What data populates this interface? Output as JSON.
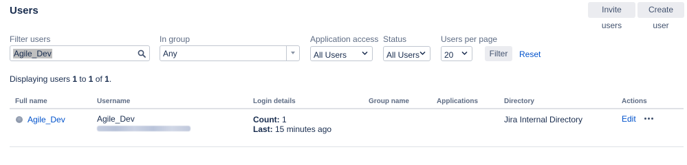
{
  "page": {
    "title": "Users"
  },
  "header": {
    "invite_label": "Invite users",
    "create_label": "Create user"
  },
  "filters": {
    "filter_users": {
      "label": "Filter users",
      "value": "Agile_Dev",
      "icon": "search-icon"
    },
    "in_group": {
      "label": "In group",
      "value": "Any"
    },
    "application_access": {
      "label": "Application access",
      "value": "All Users"
    },
    "status": {
      "label": "Status",
      "value": "All Users"
    },
    "users_per_page": {
      "label": "Users per page",
      "value": "20"
    },
    "filter_button": "Filter",
    "reset_link": "Reset"
  },
  "summary": {
    "prefix": "Displaying users ",
    "from": "1",
    "to_word": " to ",
    "to": "1",
    "of_word": " of ",
    "total": "1",
    "suffix": "."
  },
  "table": {
    "columns": [
      "Full name",
      "Username",
      "Login details",
      "Group name",
      "Applications",
      "Directory",
      "Actions"
    ],
    "rows": [
      {
        "full_name": "Agile_Dev",
        "username": "Agile_Dev",
        "count_label": "Count:",
        "count_value": " 1",
        "last_label": "Last:",
        "last_value": " 15 minutes ago",
        "group_name": "",
        "applications": "",
        "directory": "Jira Internal Directory",
        "edit_label": "Edit"
      }
    ]
  },
  "colors": {
    "link": "#0052cc",
    "text": "#172b4d",
    "muted": "#5e6c84",
    "button_bg": "#ebecf0"
  }
}
